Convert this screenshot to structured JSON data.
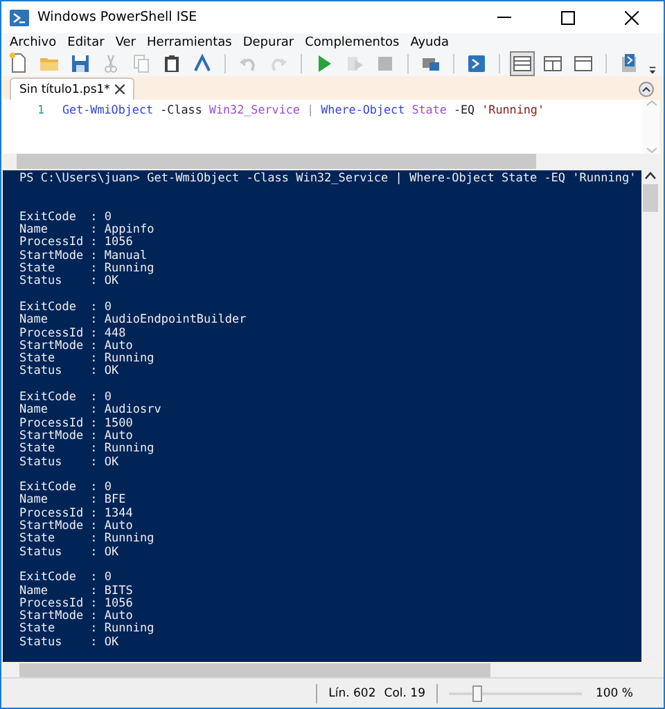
{
  "window": {
    "title": "Windows PowerShell ISE"
  },
  "menu": [
    "Archivo",
    "Editar",
    "Ver",
    "Herramientas",
    "Depurar",
    "Complementos",
    "Ayuda"
  ],
  "toolbar": [
    {
      "kind": "new",
      "disabled": false
    },
    {
      "kind": "open",
      "disabled": false
    },
    {
      "kind": "save",
      "disabled": false
    },
    {
      "kind": "cut",
      "disabled": true
    },
    {
      "kind": "copy",
      "disabled": true
    },
    {
      "kind": "paste",
      "disabled": false
    },
    {
      "kind": "clear",
      "disabled": false
    },
    {
      "kind": "separator"
    },
    {
      "kind": "undo",
      "disabled": true
    },
    {
      "kind": "redo",
      "disabled": true
    },
    {
      "kind": "separator"
    },
    {
      "kind": "run",
      "disabled": false
    },
    {
      "kind": "runsel",
      "disabled": true
    },
    {
      "kind": "stop",
      "disabled": true
    },
    {
      "kind": "separator"
    },
    {
      "kind": "remote",
      "disabled": false
    },
    {
      "kind": "separator"
    },
    {
      "kind": "shell",
      "disabled": false
    },
    {
      "kind": "separator"
    },
    {
      "kind": "pane-top",
      "selected": true
    },
    {
      "kind": "pane-right",
      "selected": false
    },
    {
      "kind": "pane-max",
      "selected": false
    },
    {
      "kind": "separator"
    },
    {
      "kind": "addon",
      "disabled": false
    },
    {
      "kind": "overflow"
    }
  ],
  "tabs": [
    {
      "label": "Sin título1.ps1*",
      "selected": true
    }
  ],
  "editor": {
    "lines": [
      {
        "number": "1",
        "tokens": [
          {
            "kind": "command",
            "text": "Get-WmiObject"
          },
          {
            "kind": "parameter",
            "text": "-Class"
          },
          {
            "kind": "argument",
            "text": "Win32_Service"
          },
          {
            "kind": "operator",
            "text": "|"
          },
          {
            "kind": "command",
            "text": "Where-Object"
          },
          {
            "kind": "argument",
            "text": "State"
          },
          {
            "kind": "parameter",
            "text": "-EQ"
          },
          {
            "kind": "string",
            "text": "'Running'"
          }
        ]
      }
    ]
  },
  "console": {
    "prompt": "PS C:\\Users\\juan> Get-WmiObject -Class Win32_Service | Where-Object State -EQ 'Running'",
    "records": [
      [
        "ExitCode  : 0",
        "Name      : Appinfo",
        "ProcessId : 1056",
        "StartMode : Manual",
        "State     : Running",
        "Status    : OK"
      ],
      [
        "ExitCode  : 0",
        "Name      : AudioEndpointBuilder",
        "ProcessId : 448",
        "StartMode : Auto",
        "State     : Running",
        "Status    : OK"
      ],
      [
        "ExitCode  : 0",
        "Name      : Audiosrv",
        "ProcessId : 1500",
        "StartMode : Auto",
        "State     : Running",
        "Status    : OK"
      ],
      [
        "ExitCode  : 0",
        "Name      : BFE",
        "ProcessId : 1344",
        "StartMode : Auto",
        "State     : Running",
        "Status    : OK"
      ],
      [
        "ExitCode  : 0",
        "Name      : BITS",
        "ProcessId : 1056",
        "StartMode : Auto",
        "State     : Running",
        "Status    : OK"
      ]
    ]
  },
  "status_bar": {
    "line": "Lín. 602",
    "column": "Col. 19",
    "zoom": {
      "level": 0.21
    },
    "zoom_text": "100 %"
  }
}
